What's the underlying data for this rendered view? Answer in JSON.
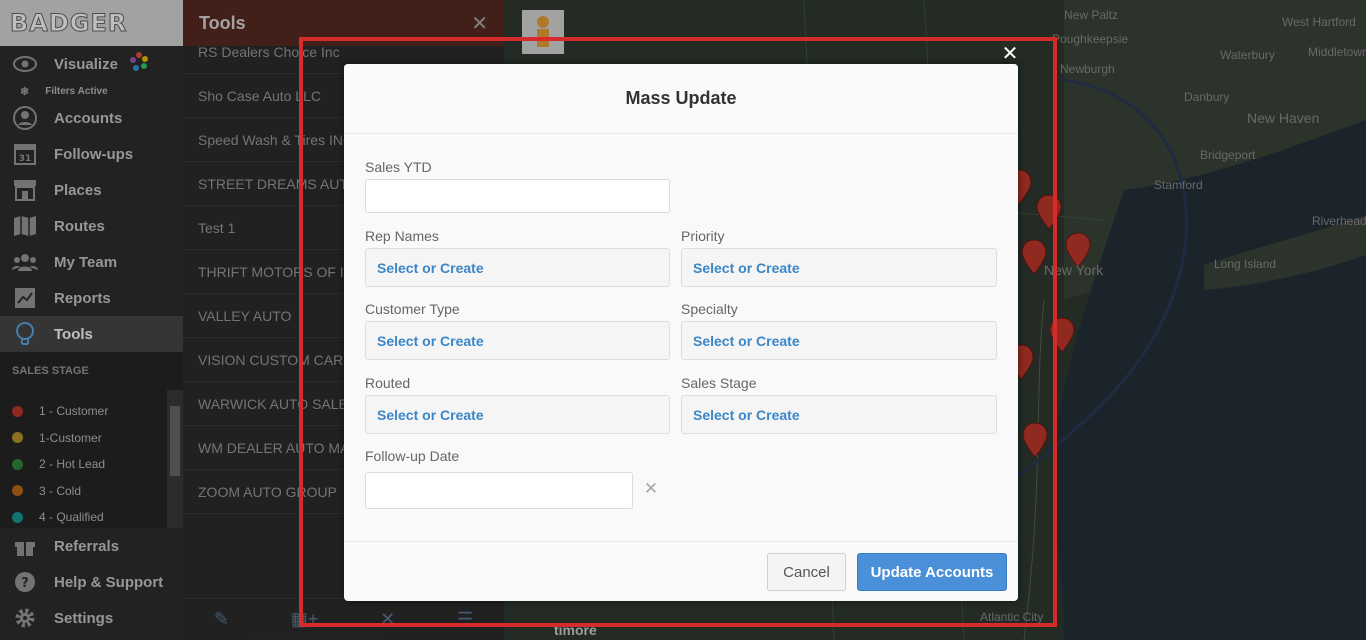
{
  "sidebar": {
    "logo": "BADGER",
    "nav_top": [
      {
        "label": "Visualize",
        "icon": "eye-icon"
      }
    ],
    "filters_active": "Filters Active",
    "nav": [
      {
        "label": "Accounts",
        "icon": "user-circle-icon"
      },
      {
        "label": "Follow-ups",
        "icon": "calendar-icon"
      },
      {
        "label": "Places",
        "icon": "store-icon"
      },
      {
        "label": "Routes",
        "icon": "map-icon"
      },
      {
        "label": "My Team",
        "icon": "team-icon"
      },
      {
        "label": "Reports",
        "icon": "chart-icon"
      },
      {
        "label": "Tools",
        "icon": "lightbulb-icon"
      }
    ],
    "sales_stage_heading": "SALES STAGE",
    "stages": [
      {
        "label": "1 - Customer",
        "color": "#c0392b"
      },
      {
        "label": "1-Customer",
        "color": "#b8962e"
      },
      {
        "label": "2 - Hot Lead",
        "color": "#2e8b3d"
      },
      {
        "label": "3 - Cold",
        "color": "#c06a1a"
      },
      {
        "label": "4 - Qualified",
        "color": "#1a9a9a"
      }
    ],
    "nav_bottom": [
      {
        "label": "Referrals",
        "icon": "gift-icon"
      },
      {
        "label": "Help & Support",
        "icon": "help-icon"
      },
      {
        "label": "Settings",
        "icon": "gear-icon"
      }
    ]
  },
  "tools_panel": {
    "title": "Tools",
    "rows": [
      "RS Dealers Choice Inc",
      "Sho Case Auto LLC",
      "Speed Wash & Tires INC",
      "STREET DREAMS AUTO",
      "Test 1",
      "THRIFT MOTORS OF IN",
      "VALLEY AUTO",
      "VISION CUSTOM CARS",
      "WARWICK AUTO SALES",
      "WM DEALER AUTO MA",
      "ZOOM AUTO GROUP"
    ]
  },
  "map": {
    "labels": [
      "New Paltz",
      "West Hartford",
      "Middletown",
      "Poughkeepsie",
      "Waterbury",
      "Newburgh",
      "Danbury",
      "New Haven",
      "Bridgeport",
      "Stamford",
      "Riverhead",
      "New York",
      "Long Island",
      "Atlantic City",
      "timore"
    ]
  },
  "modal": {
    "title": "Mass Update",
    "fields": {
      "sales_ytd": "Sales YTD",
      "rep_names": "Rep Names",
      "priority": "Priority",
      "customer_type": "Customer Type",
      "specialty": "Specialty",
      "routed": "Routed",
      "sales_stage": "Sales Stage",
      "follow_up_date": "Follow-up Date"
    },
    "select_placeholder": "Select or Create",
    "cancel_label": "Cancel",
    "update_label": "Update Accounts"
  }
}
